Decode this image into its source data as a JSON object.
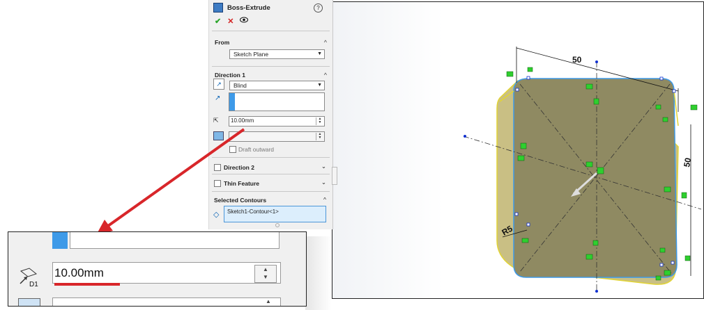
{
  "feature": {
    "title": "Boss-Extrude",
    "help_icon": "?",
    "ok_icon": "✔",
    "cancel_icon": "✕",
    "preview_icon": "eye-icon"
  },
  "from_group": {
    "label": "From",
    "selected": "Sketch Plane"
  },
  "direction1": {
    "label": "Direction 1",
    "end_condition": "Blind",
    "depth": "10.00mm",
    "draft_label": "Draft outward"
  },
  "direction2": {
    "label": "Direction 2"
  },
  "thin_feature": {
    "label": "Thin Feature"
  },
  "selected_contours": {
    "label": "Selected Contours",
    "item": "Sketch1-Contour<1>"
  },
  "zoom_inset": {
    "depth": "10.00mm",
    "icon_label": "D1"
  },
  "model": {
    "dim_width": "50",
    "dim_height": "50",
    "dim_radius": "R5"
  },
  "colors": {
    "selection_blue": "#3e9ae8",
    "callout_red": "#d8262a",
    "relation_green": "#2fcf2f",
    "preview_fill": "#9a9260"
  }
}
